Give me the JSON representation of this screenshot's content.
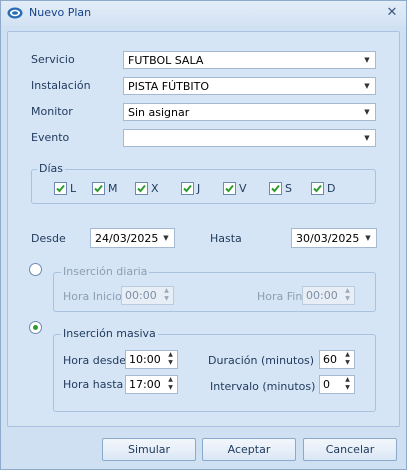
{
  "window": {
    "title": "Nuevo Plan",
    "close_glyph": "✕"
  },
  "form": {
    "servicio": {
      "label": "Servicio",
      "value": "FUTBOL SALA"
    },
    "instalacion": {
      "label": "Instalación",
      "value": "PISTA FÚTBITO"
    },
    "monitor": {
      "label": "Monitor",
      "value": "Sin asignar"
    },
    "evento": {
      "label": "Evento",
      "value": ""
    }
  },
  "dias": {
    "title": "Días",
    "items": [
      {
        "label": "L",
        "checked": true
      },
      {
        "label": "M",
        "checked": true
      },
      {
        "label": "X",
        "checked": true
      },
      {
        "label": "J",
        "checked": true
      },
      {
        "label": "V",
        "checked": true
      },
      {
        "label": "S",
        "checked": true
      },
      {
        "label": "D",
        "checked": true
      }
    ]
  },
  "fechas": {
    "desde_label": "Desde",
    "desde_value": "24/03/2025",
    "hasta_label": "Hasta",
    "hasta_value": "30/03/2025"
  },
  "insercion_diaria": {
    "title": "Inserción diaria",
    "selected": false,
    "hora_inicio_label": "Hora Inicio",
    "hora_inicio_value": "00:00",
    "hora_fin_label": "Hora Fin",
    "hora_fin_value": "00:00"
  },
  "insercion_masiva": {
    "title": "Inserción masiva",
    "selected": true,
    "hora_desde_label": "Hora desde",
    "hora_desde_value": "10:00",
    "hora_hasta_label": "Hora hasta",
    "hora_hasta_value": "17:00",
    "duracion_label": "Duración (minutos)",
    "duracion_value": "60",
    "intervalo_label": "Intervalo (minutos)",
    "intervalo_value": "0"
  },
  "buttons": {
    "simular": "Simular",
    "aceptar": "Aceptar",
    "cancelar": "Cancelar"
  },
  "colors": {
    "accent": "#2f9b2f",
    "background": "#d6e5f6",
    "border": "#a9c2df"
  }
}
